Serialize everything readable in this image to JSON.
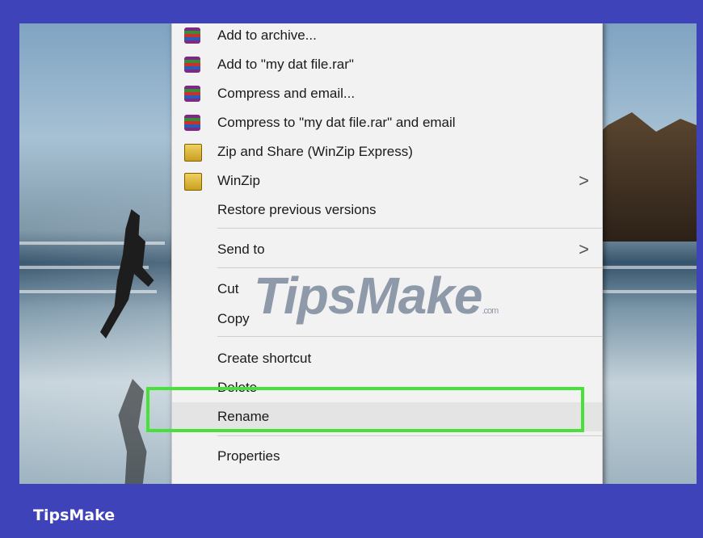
{
  "menu": {
    "items": [
      {
        "label": "Add to archive...",
        "icon": "winrar-icon"
      },
      {
        "label": "Add to \"my dat file.rar\"",
        "icon": "winrar-icon"
      },
      {
        "label": "Compress and email...",
        "icon": "winrar-icon"
      },
      {
        "label": "Compress to \"my dat file.rar\" and email",
        "icon": "winrar-icon"
      },
      {
        "label": "Zip and Share (WinZip Express)",
        "icon": "winzip-icon"
      },
      {
        "label": "WinZip",
        "icon": "winzip-icon",
        "submenu": true
      },
      {
        "label": "Restore previous versions"
      },
      {
        "label": "Send to",
        "submenu": true
      },
      {
        "label": "Cut"
      },
      {
        "label": "Copy"
      },
      {
        "label": "Create shortcut"
      },
      {
        "label": "Delete"
      },
      {
        "label": "Rename",
        "highlighted": true
      },
      {
        "label": "Properties"
      }
    ],
    "submenu_arrow": ">"
  },
  "watermark": {
    "text": "TipsMake",
    "suffix": ".com"
  },
  "footer": {
    "brand": "TipsMake"
  },
  "colors": {
    "highlight": "#47e13a",
    "footer_bg": "#3f43b9",
    "menu_bg": "#f2f2f2"
  }
}
